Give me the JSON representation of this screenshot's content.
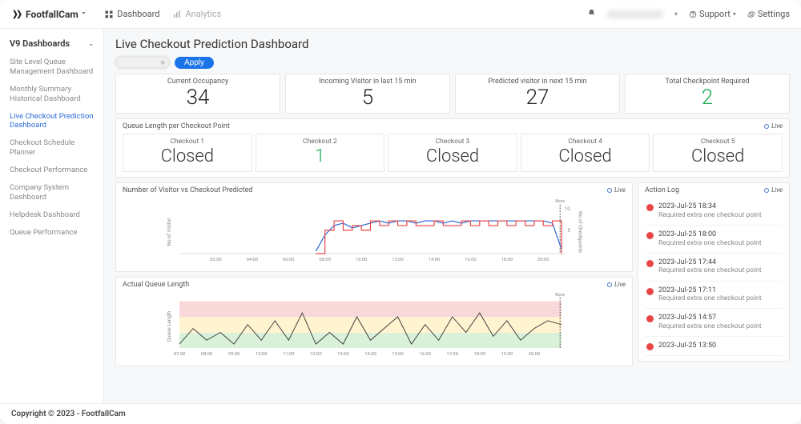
{
  "brand": {
    "name": "FootfallCam",
    "tm": "™"
  },
  "topnav": {
    "dashboard": "Dashboard",
    "analytics": "Analytics",
    "support": "Support",
    "settings": "Settings"
  },
  "sidebar": {
    "heading": "V9 Dashboards",
    "items": [
      {
        "label": "Site Level Queue Management Dashboard",
        "active": false
      },
      {
        "label": "Monthly Summary Historical Dashboard",
        "active": false
      },
      {
        "label": "Live Checkout Prediction Dashboard",
        "active": true
      },
      {
        "label": "Checkout Schedule Planner",
        "active": false
      },
      {
        "label": "Checkout Performance",
        "active": false
      },
      {
        "label": "Company System Dashboard",
        "active": false
      },
      {
        "label": "Helpdesk Dashboard",
        "active": false
      },
      {
        "label": "Queue Performance",
        "active": false
      }
    ]
  },
  "page": {
    "title": "Live Checkout Prediction Dashboard",
    "apply": "Apply"
  },
  "kpi": [
    {
      "label": "Current Occupancy",
      "value": "34"
    },
    {
      "label": "Incoming Visitor in last 15 min",
      "value": "5"
    },
    {
      "label": "Predicted visitor in next 15 min",
      "value": "27"
    },
    {
      "label": "Total Checkpoint Required",
      "value": "2",
      "green": true
    }
  ],
  "queue": {
    "title": "Queue Length per Checkout Point",
    "live": "Live",
    "items": [
      {
        "label": "Checkout 1",
        "value": "Closed"
      },
      {
        "label": "Checkout 2",
        "value": "1",
        "green": true
      },
      {
        "label": "Checkout 3",
        "value": "Closed"
      },
      {
        "label": "Checkout 4",
        "value": "Closed"
      },
      {
        "label": "Checkout 5",
        "value": "Closed"
      }
    ]
  },
  "chart1": {
    "title": "Number of Visitor vs Checkout Predicted",
    "live": "Live",
    "ylabel_l": "No of Visitor",
    "ylabel_r": "No of Checkpoints",
    "now": "Now",
    "y_right_max": "10",
    "y_right_mid": "5",
    "xticks": [
      "02:00",
      "04:00",
      "06:00",
      "08:00",
      "10:00",
      "12:00",
      "14:00",
      "16:00",
      "18:00",
      "20:00"
    ]
  },
  "chart2": {
    "title": "Actual Queue Length",
    "live": "Live",
    "ylabel": "Queue Length",
    "now": "Now",
    "xticks": [
      "07:00",
      "08:00",
      "09:00",
      "10:00",
      "11:00",
      "12:00",
      "13:00",
      "14:00",
      "15:00",
      "16:00",
      "17:00",
      "18:00",
      "19:00",
      "20:00"
    ]
  },
  "actionlog": {
    "title": "Action Log",
    "live": "Live",
    "items": [
      {
        "time": "2023-Jul-25 18:34",
        "msg": "Required extra one checkout point"
      },
      {
        "time": "2023-Jul-25 18:00",
        "msg": "Required extra one checkout point"
      },
      {
        "time": "2023-Jul-25 17:44",
        "msg": "Required extra one checkout point"
      },
      {
        "time": "2023-Jul-25 17:11",
        "msg": "Required extra one checkout point"
      },
      {
        "time": "2023-Jul-25 14:57",
        "msg": "Required extra one checkout point"
      },
      {
        "time": "2023-Jul-25 13:50",
        "msg": ""
      }
    ]
  },
  "footer": "Copyright © 2023 - FootfallCam",
  "chart_data": [
    {
      "type": "line",
      "title": "Number of Visitor vs Checkout Predicted",
      "xlabel": "",
      "x_range": [
        "00:00",
        "21:00"
      ],
      "now_line_at": "21:00",
      "series": [
        {
          "name": "No of Visitor",
          "axis": "left",
          "color": "#2a62d6",
          "points": [
            [
              "07:30",
              0.5
            ],
            [
              "08:00",
              4
            ],
            [
              "08:30",
              6
            ],
            [
              "09:00",
              6.5
            ],
            [
              "09:30",
              5.5
            ],
            [
              "10:00",
              6
            ],
            [
              "10:30",
              6.5
            ],
            [
              "11:00",
              7
            ],
            [
              "11:30",
              6.5
            ],
            [
              "12:00",
              7
            ],
            [
              "12:30",
              7
            ],
            [
              "13:00",
              6.5
            ],
            [
              "13:30",
              7
            ],
            [
              "14:00",
              7
            ],
            [
              "14:30",
              6.5
            ],
            [
              "15:00",
              7
            ],
            [
              "15:30",
              6.5
            ],
            [
              "16:00",
              7
            ],
            [
              "16:30",
              7
            ],
            [
              "17:00",
              7
            ],
            [
              "17:30",
              7
            ],
            [
              "18:00",
              7
            ],
            [
              "18:30",
              7
            ],
            [
              "19:00",
              7
            ],
            [
              "19:30",
              7
            ],
            [
              "20:00",
              7
            ],
            [
              "20:30",
              6.5
            ],
            [
              "21:00",
              1
            ]
          ]
        },
        {
          "name": "No of Checkpoints",
          "axis": "right",
          "color": "#e94545",
          "ylim": [
            0,
            10
          ],
          "step": true,
          "points": [
            [
              "07:30",
              0
            ],
            [
              "08:00",
              5
            ],
            [
              "08:30",
              7
            ],
            [
              "09:00",
              5
            ],
            [
              "09:30",
              6
            ],
            [
              "10:00",
              5
            ],
            [
              "10:30",
              7
            ],
            [
              "11:00",
              6
            ],
            [
              "11:30",
              7
            ],
            [
              "12:00",
              6
            ],
            [
              "12:30",
              7
            ],
            [
              "13:00",
              6
            ],
            [
              "13:30",
              6
            ],
            [
              "14:00",
              7
            ],
            [
              "14:30",
              6
            ],
            [
              "15:00",
              6
            ],
            [
              "15:30",
              7
            ],
            [
              "16:00",
              6
            ],
            [
              "16:30",
              7
            ],
            [
              "17:00",
              6
            ],
            [
              "17:30",
              7
            ],
            [
              "18:00",
              6
            ],
            [
              "18:30",
              7
            ],
            [
              "19:00",
              6
            ],
            [
              "19:30",
              7
            ],
            [
              "20:00",
              6
            ],
            [
              "20:30",
              7
            ],
            [
              "21:00",
              0
            ]
          ]
        }
      ]
    },
    {
      "type": "line",
      "title": "Actual Queue Length",
      "xlabel": "",
      "ylabel": "Queue Length",
      "x_range": [
        "07:00",
        "21:00"
      ],
      "ylim": [
        0,
        6
      ],
      "now_line_at": "21:00",
      "bands": [
        {
          "from": 0,
          "to": 2,
          "color": "#d9f0d9"
        },
        {
          "from": 2,
          "to": 4,
          "color": "#fff3d0"
        },
        {
          "from": 4,
          "to": 6,
          "color": "#f8d8d8"
        }
      ],
      "series": [
        {
          "name": "Queue Length",
          "color": "#333",
          "points": [
            [
              "07:00",
              0.5
            ],
            [
              "07:30",
              2.5
            ],
            [
              "08:00",
              1
            ],
            [
              "08:30",
              2
            ],
            [
              "09:00",
              0.5
            ],
            [
              "09:30",
              3
            ],
            [
              "10:00",
              1
            ],
            [
              "10:30",
              3.5
            ],
            [
              "11:00",
              1
            ],
            [
              "11:30",
              4.5
            ],
            [
              "12:00",
              0.5
            ],
            [
              "12:30",
              2
            ],
            [
              "13:00",
              0.5
            ],
            [
              "13:30",
              4
            ],
            [
              "14:00",
              1
            ],
            [
              "14:30",
              2.5
            ],
            [
              "15:00",
              4
            ],
            [
              "15:30",
              0.5
            ],
            [
              "16:00",
              3
            ],
            [
              "16:30",
              1
            ],
            [
              "17:00",
              4
            ],
            [
              "17:30",
              2
            ],
            [
              "18:00",
              4.5
            ],
            [
              "18:30",
              1.5
            ],
            [
              "19:00",
              3.5
            ],
            [
              "19:30",
              1
            ],
            [
              "20:00",
              2.5
            ],
            [
              "20:30",
              3.5
            ],
            [
              "21:00",
              3
            ]
          ]
        }
      ]
    }
  ]
}
